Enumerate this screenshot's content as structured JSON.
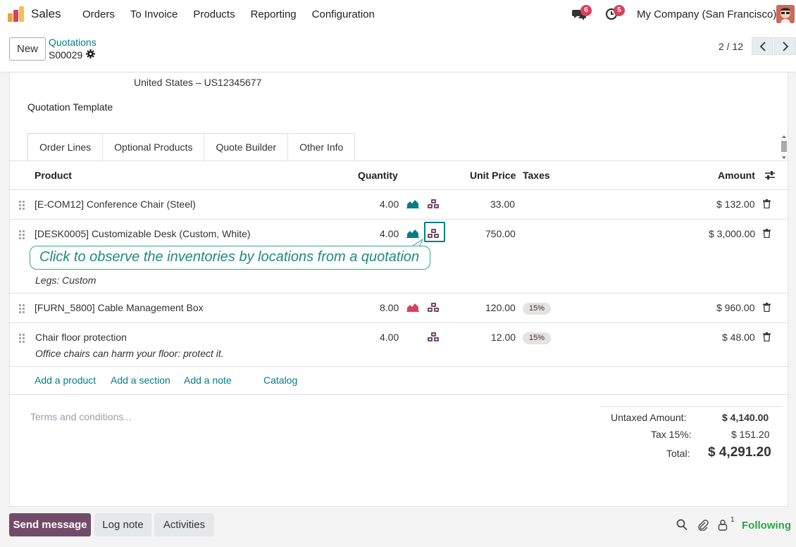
{
  "navbar": {
    "app_name": "Sales",
    "menu": [
      "Orders",
      "To Invoice",
      "Products",
      "Reporting",
      "Configuration"
    ],
    "messages_count": "6",
    "activities_count": "5",
    "company": "My Company (San Francisco)"
  },
  "control": {
    "new_label": "New",
    "breadcrumb_parent": "Quotations",
    "breadcrumb_current": "S00029",
    "pager": "2 / 12"
  },
  "form": {
    "address_line": "United States – US12345677",
    "quotation_template_label": "Quotation Template",
    "tabs": [
      "Order Lines",
      "Optional Products",
      "Quote Builder",
      "Other Info"
    ],
    "columns": {
      "product": "Product",
      "quantity": "Quantity",
      "unit_price": "Unit Price",
      "taxes": "Taxes",
      "amount": "Amount"
    },
    "lines": [
      {
        "product": "[E-COM12] Conference Chair (Steel)",
        "quantity": "4.00",
        "unit_price": "33.00",
        "tax": "",
        "amount": "$ 132.00",
        "forecast_color": "#017e84"
      },
      {
        "product": "[DESK0005] Customizable Desk (Custom, White)",
        "quantity": "4.00",
        "unit_price": "750.00",
        "tax": "",
        "amount": "$ 3,000.00",
        "description": "Legs: Custom",
        "forecast_color": "#017e84"
      },
      {
        "product": "[FURN_5800] Cable Management Box",
        "quantity": "8.00",
        "unit_price": "120.00",
        "tax": "15%",
        "amount": "$ 960.00",
        "forecast_color": "#d9415e"
      },
      {
        "product": "Chair floor protection",
        "quantity": "4.00",
        "unit_price": "12.00",
        "tax": "15%",
        "amount": "$ 48.00",
        "description": "Office chairs can harm your floor: protect it."
      }
    ],
    "tooltip": "Click to observe the inventories by locations from a quotation",
    "add_links": [
      "Add a product",
      "Add a section",
      "Add a note",
      "Catalog"
    ],
    "terms_placeholder": "Terms and conditions...",
    "totals": {
      "untaxed_label": "Untaxed Amount:",
      "untaxed_value": "$ 4,140.00",
      "tax_label": "Tax 15%:",
      "tax_value": "$ 151.20",
      "total_label": "Total:",
      "total_value": "$ 4,291.20"
    }
  },
  "chatter": {
    "send_message": "Send message",
    "log_note": "Log note",
    "activities": "Activities",
    "followers_count": "1",
    "following": "Following"
  },
  "colors": {
    "brand": "#714b67",
    "link": "#017e84",
    "badge": "#d9415e",
    "following": "#28a745"
  }
}
